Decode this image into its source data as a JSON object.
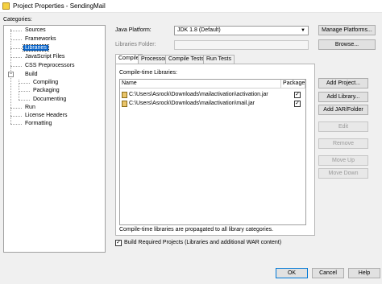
{
  "window": {
    "title": "Project Properties - SendingMail"
  },
  "categories": {
    "label": "Categories:",
    "items": [
      {
        "label": "Sources"
      },
      {
        "label": "Frameworks"
      },
      {
        "label": "Libraries"
      },
      {
        "label": "JavaScript Files"
      },
      {
        "label": "CSS Preprocessors"
      },
      {
        "label": "Build"
      },
      {
        "label": "Compiling"
      },
      {
        "label": "Packaging"
      },
      {
        "label": "Documenting"
      },
      {
        "label": "Run"
      },
      {
        "label": "License Headers"
      },
      {
        "label": "Formatting"
      }
    ],
    "selected": "Libraries"
  },
  "platform": {
    "label": "Java Platform:",
    "value": "JDK 1.8 (Default)",
    "manage_label": "Manage Platforms..."
  },
  "libraries_folder": {
    "label": "Libraries Folder:",
    "value": "",
    "browse_label": "Browse..."
  },
  "tabs": [
    {
      "label": "Compile",
      "active": true
    },
    {
      "label": "Processor",
      "active": false
    },
    {
      "label": "Compile Tests",
      "active": false
    },
    {
      "label": "Run Tests",
      "active": false
    }
  ],
  "compile": {
    "section_label": "Compile-time Libraries:",
    "columns": {
      "name": "Name",
      "package": "Package"
    },
    "rows": [
      {
        "path": "C:\\Users\\Asrock\\Downloads\\mailactivation\\activation.jar",
        "package": true
      },
      {
        "path": "C:\\Users\\Asrock\\Downloads\\mailactivation\\mail.jar",
        "package": true
      }
    ],
    "note": "Compile-time libraries are propagated to all library categories."
  },
  "side_buttons": {
    "add_project": "Add Project...",
    "add_library": "Add Library...",
    "add_jar": "Add JAR/Folder",
    "edit": "Edit",
    "remove": "Remove",
    "move_up": "Move Up",
    "move_down": "Move Down"
  },
  "build_required": {
    "label": "Build Required Projects (Libraries and additional WAR content)",
    "checked": true
  },
  "footer": {
    "ok": "OK",
    "cancel": "Cancel",
    "help": "Help"
  },
  "colors": {
    "selection": "#0a64c8",
    "focus_border": "#0078d7"
  }
}
